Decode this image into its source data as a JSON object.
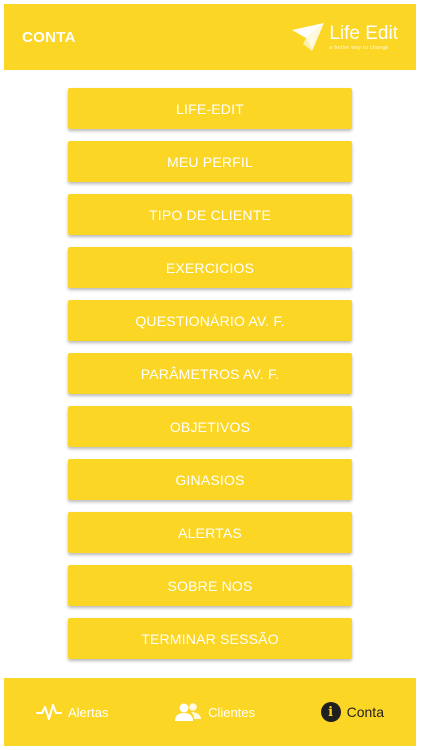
{
  "header": {
    "title": "CONTA",
    "logo_name": "Life Edit",
    "logo_tagline": "a better way to change",
    "logo_icon": "paper-plane-icon"
  },
  "menu": {
    "items": [
      {
        "label": "LIFE-EDIT"
      },
      {
        "label": "MEU PERFIL"
      },
      {
        "label": "TIPO DE CLIENTE"
      },
      {
        "label": "EXERCICIOS"
      },
      {
        "label": "QUESTIONÁRIO AV. F."
      },
      {
        "label": "PARÂMETROS AV. F."
      },
      {
        "label": "OBJETIVOS"
      },
      {
        "label": "GINASIOS"
      },
      {
        "label": "ALERTAS"
      },
      {
        "label": "SOBRE NOS"
      },
      {
        "label": "TERMINAR SESSÃO"
      }
    ]
  },
  "bottom_nav": {
    "items": [
      {
        "label": "Alertas",
        "icon": "heartbeat-icon"
      },
      {
        "label": "Clientes",
        "icon": "users-icon"
      },
      {
        "label": "Conta",
        "icon": "info-icon",
        "active": true
      }
    ]
  },
  "colors": {
    "accent": "#fcd624",
    "text_on_accent": "#ffffff",
    "active_text": "#222222"
  }
}
